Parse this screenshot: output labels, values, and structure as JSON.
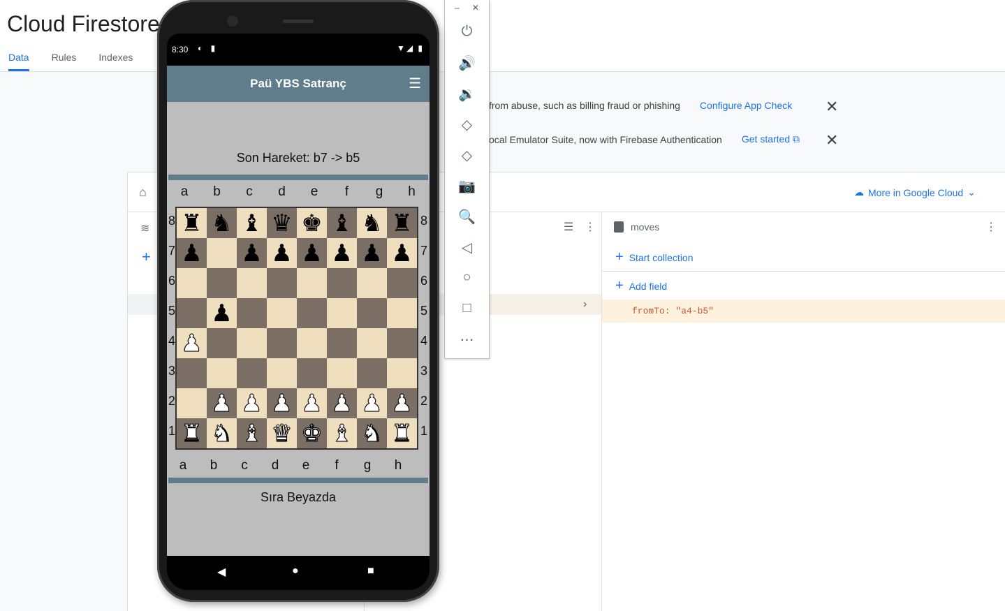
{
  "console": {
    "title": "Cloud Firestore",
    "tabs": [
      {
        "label": "Data",
        "active": true
      },
      {
        "label": "Rules",
        "active": false
      },
      {
        "label": "Indexes",
        "active": false
      }
    ],
    "banners": [
      {
        "text": "from abuse, such as billing fraud or phishing",
        "link": "Configure App Check"
      },
      {
        "text": "ocal Emulator Suite, now with Firebase Authentication",
        "link": "Get started"
      }
    ],
    "more_cloud": "More in Google Cloud",
    "document": {
      "name": "moves",
      "start_collection": "Start collection",
      "add_field": "Add field",
      "field_key": "fromTo",
      "field_value": "\"a4-b5\""
    }
  },
  "emulator": {
    "buttons": [
      "power-icon",
      "volume-up-icon",
      "volume-down-icon",
      "rotate-left-icon",
      "rotate-right-icon",
      "camera-icon",
      "zoom-icon",
      "back-icon",
      "home-icon",
      "overview-icon",
      "more-icon"
    ]
  },
  "phone": {
    "time": "8:30",
    "app_title": "Paü YBS Satranç",
    "last_move": "Son Hareket:  b7 -> b5",
    "turn": "Sıra Beyazda",
    "files_top": [
      "a",
      "b",
      "c",
      "d",
      "e",
      "f",
      "g",
      "h"
    ],
    "files_bottom": [
      "a",
      "b",
      "c",
      "d",
      "e",
      "f",
      "g",
      "h"
    ],
    "ranks": [
      "8",
      "7",
      "6",
      "5",
      "4",
      "3",
      "2",
      "1"
    ],
    "board": [
      [
        "br",
        "bn",
        "bb",
        "bq",
        "bk",
        "bb",
        "bn",
        "br"
      ],
      [
        "bp",
        "",
        "bp",
        "bp",
        "bp",
        "bp",
        "bp",
        "bp"
      ],
      [
        "",
        "",
        "",
        "",
        "",
        "",
        "",
        ""
      ],
      [
        "",
        "bp",
        "",
        "",
        "",
        "",
        "",
        ""
      ],
      [
        "wp",
        "",
        "",
        "",
        "",
        "",
        "",
        ""
      ],
      [
        "",
        "",
        "",
        "",
        "",
        "",
        "",
        ""
      ],
      [
        "",
        "wp",
        "wp",
        "wp",
        "wp",
        "wp",
        "wp",
        "wp"
      ],
      [
        "wr",
        "wn",
        "wb",
        "wq",
        "wk",
        "wb",
        "wn",
        "wr"
      ]
    ]
  }
}
